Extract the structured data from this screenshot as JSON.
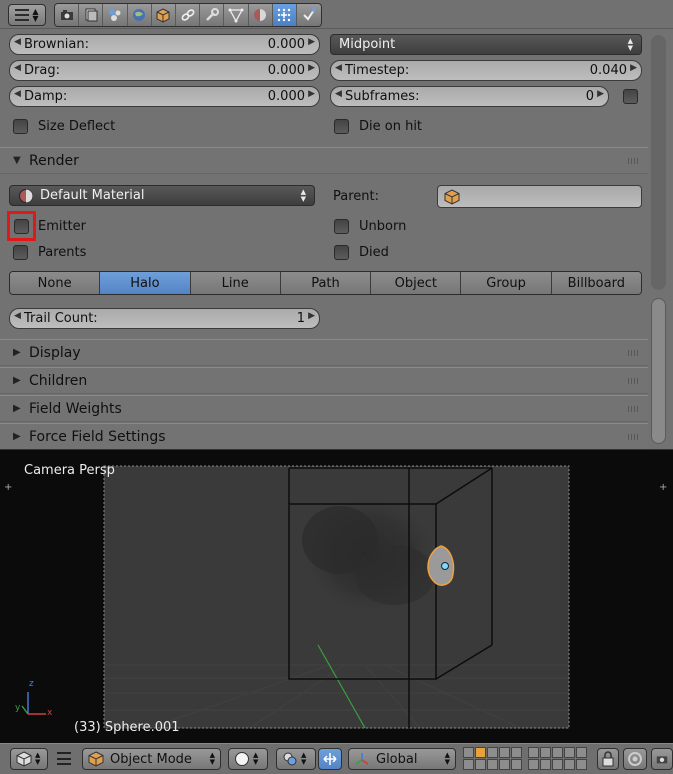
{
  "colors": {
    "panel_bg": "#727272",
    "accent_blue": "#5b8bd0",
    "highlight_red": "#e01818",
    "selection_orange": "#e8a23c",
    "viewport_bg": "#0b0b0b"
  },
  "header": {
    "menu_icon": "editor-type-menu-icon",
    "context_tabs": [
      {
        "name": "render-icon"
      },
      {
        "name": "render-layers-icon"
      },
      {
        "name": "scene-icon"
      },
      {
        "name": "world-icon"
      },
      {
        "name": "object-icon"
      },
      {
        "name": "constraints-icon"
      },
      {
        "name": "modifiers-icon"
      },
      {
        "name": "object-data-icon"
      },
      {
        "name": "material-icon"
      },
      {
        "name": "particles-icon",
        "active": true
      },
      {
        "name": "physics-icon"
      }
    ]
  },
  "physics": {
    "brownian": {
      "label": "Brownian:",
      "value": "0.000"
    },
    "drag": {
      "label": "Drag:",
      "value": "0.000"
    },
    "damp": {
      "label": "Damp:",
      "value": "0.000"
    },
    "integrator": "Midpoint",
    "timestep": {
      "label": "Timestep:",
      "value": "0.040"
    },
    "subframes": {
      "label": "Subframes:",
      "value": "0"
    },
    "size_deflect": "Size Deflect",
    "die_on_hit": "Die on hit"
  },
  "render_panel": {
    "title": "Render",
    "material": "Default Material",
    "parent_label": "Parent:",
    "emitter": "Emitter",
    "parents": "Parents",
    "unborn": "Unborn",
    "died": "Died",
    "render_types": [
      "None",
      "Halo",
      "Line",
      "Path",
      "Object",
      "Group",
      "Billboard"
    ],
    "active_type": "Halo",
    "trail_count": {
      "label": "Trail Count:",
      "value": "1"
    }
  },
  "collapsed_panels": [
    "Display",
    "Children",
    "Field Weights",
    "Force Field Settings"
  ],
  "viewport": {
    "view_name": "Camera Persp",
    "object_info": "(33) Sphere.001",
    "axis_x": "x",
    "axis_y": "y",
    "axis_z": "z"
  },
  "footer": {
    "mode": "Object Mode",
    "orientation": "Global"
  }
}
